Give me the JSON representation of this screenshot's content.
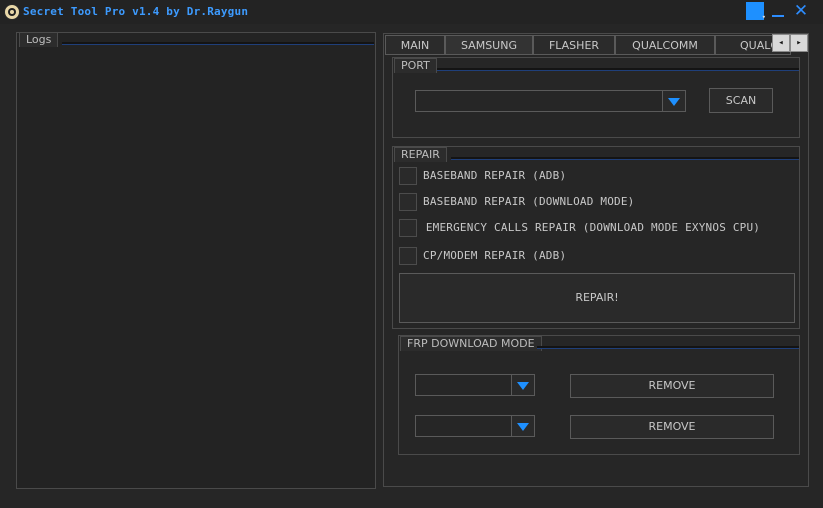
{
  "window": {
    "title": "Secret Tool Pro v1.4 by Dr.Raygun",
    "close_glyph": "✕",
    "skin_caret": "▾"
  },
  "logs": {
    "label": "Logs"
  },
  "tabs": [
    {
      "label": "MAIN"
    },
    {
      "label": "SAMSUNG"
    },
    {
      "label": "FLASHER"
    },
    {
      "label": "QUALCOMM"
    },
    {
      "label": "QUALC"
    }
  ],
  "tab_scroll": {
    "left": "◂",
    "right": "▸"
  },
  "port": {
    "label": "PORT",
    "selected": "",
    "scan_label": "SCAN"
  },
  "repair": {
    "label": "REPAIR",
    "options": [
      {
        "label": "BASEBAND REPAIR (ADB)"
      },
      {
        "label": "BASEBAND REPAIR (DOWNLOAD MODE)"
      },
      {
        "label": " EMERGENCY CALLS REPAIR (DOWNLOAD MODE EXYNOS CPU)"
      },
      {
        "label": "CP/MODEM REPAIR (ADB)"
      }
    ],
    "button_label": "REPAIR!"
  },
  "frp": {
    "label": "FRP DOWNLOAD MODE",
    "rows": [
      {
        "selected": "",
        "button_label": "REMOVE"
      },
      {
        "selected": "",
        "button_label": "REMOVE"
      }
    ]
  },
  "colors": {
    "accent": "#1e90ff",
    "title": "#3d9bff",
    "background": "#262626"
  }
}
